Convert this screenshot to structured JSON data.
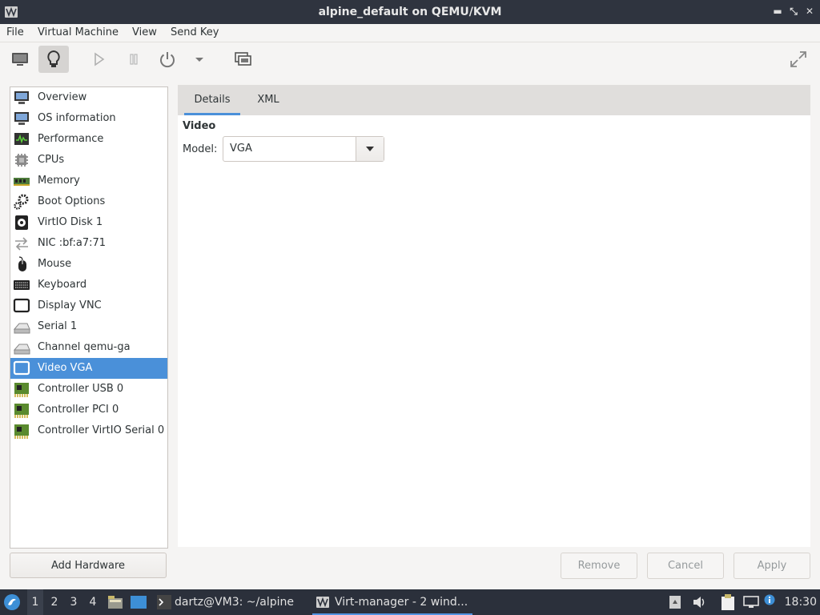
{
  "window": {
    "title": "alpine_default on QEMU/KVM"
  },
  "menubar": {
    "items": [
      "File",
      "Virtual Machine",
      "View",
      "Send Key"
    ]
  },
  "sidebar": {
    "items": [
      {
        "label": "Overview",
        "icon": "monitor-icon"
      },
      {
        "label": "OS information",
        "icon": "monitor-icon"
      },
      {
        "label": "Performance",
        "icon": "performance-graph-icon"
      },
      {
        "label": "CPUs",
        "icon": "cpu-chip-icon"
      },
      {
        "label": "Memory",
        "icon": "memory-module-icon"
      },
      {
        "label": "Boot Options",
        "icon": "gears-icon"
      },
      {
        "label": "VirtIO Disk 1",
        "icon": "disk-icon"
      },
      {
        "label": "NIC :bf:a7:71",
        "icon": "network-arrows-icon"
      },
      {
        "label": "Mouse",
        "icon": "mouse-icon"
      },
      {
        "label": "Keyboard",
        "icon": "keyboard-icon"
      },
      {
        "label": "Display VNC",
        "icon": "display-icon"
      },
      {
        "label": "Serial 1",
        "icon": "serial-port-icon"
      },
      {
        "label": "Channel qemu-ga",
        "icon": "serial-port-icon"
      },
      {
        "label": "Video VGA",
        "icon": "display-icon"
      },
      {
        "label": "Controller USB 0",
        "icon": "pci-card-icon"
      },
      {
        "label": "Controller PCI 0",
        "icon": "pci-card-icon"
      },
      {
        "label": "Controller VirtIO Serial 0",
        "icon": "pci-card-icon"
      }
    ],
    "selected": "Video VGA",
    "add_button": "Add Hardware"
  },
  "tabs": [
    {
      "label": "Details",
      "active": true
    },
    {
      "label": "XML",
      "active": false
    }
  ],
  "details": {
    "section_title": "Video",
    "model_label": "Model:",
    "model_value": "VGA"
  },
  "footer": {
    "remove": "Remove",
    "cancel": "Cancel",
    "apply": "Apply"
  },
  "taskbar": {
    "workspaces": [
      "1",
      "2",
      "3",
      "4"
    ],
    "active_workspace": "1",
    "tasks": [
      {
        "label": "dartz@VM3: ~/alpine",
        "active": false
      },
      {
        "label": "Virt-manager - 2 wind...",
        "active": true
      }
    ],
    "clock": "18:30"
  },
  "colors": {
    "accent": "#4a90d9",
    "titlebar": "#2f343f",
    "taskbar": "#2b303b"
  }
}
